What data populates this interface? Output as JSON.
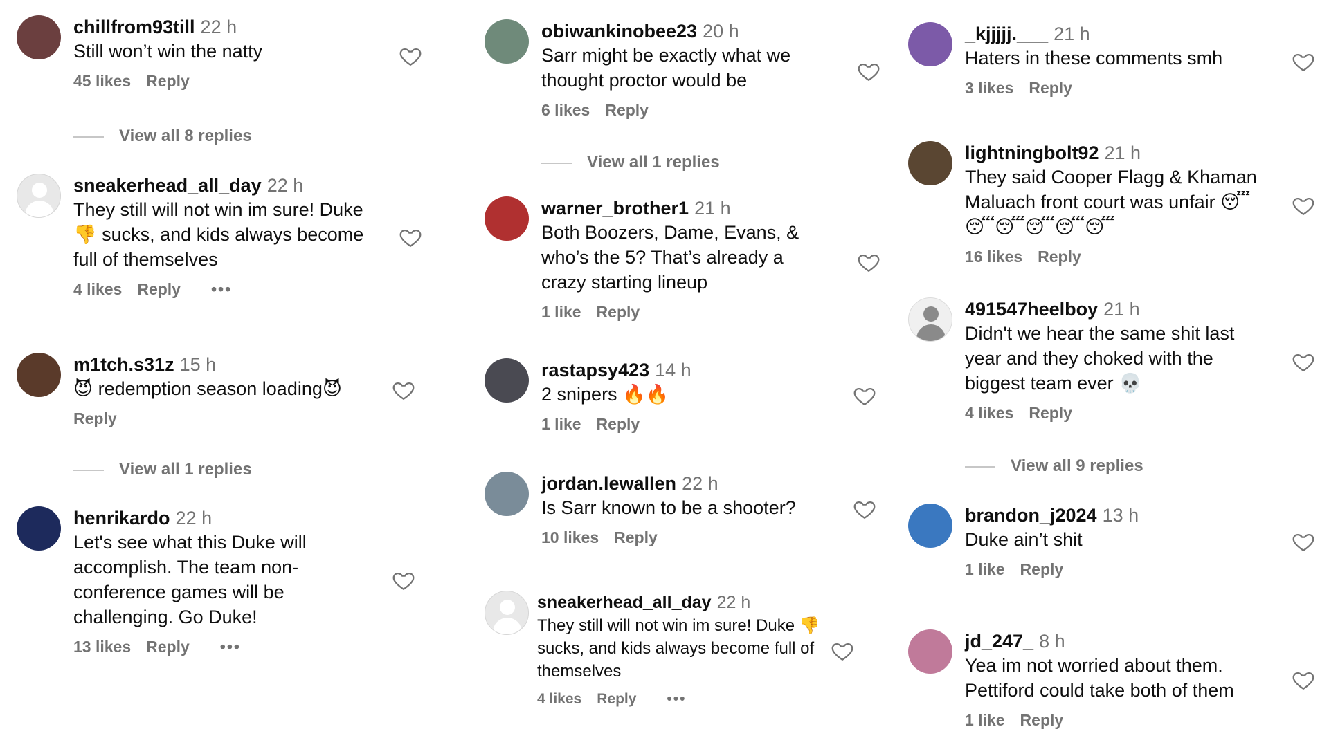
{
  "comments": [
    {
      "username": "chillfrom93till",
      "time": "22 h",
      "text": "Still won’t win the natty",
      "likes": "45 likes",
      "reply": "Reply",
      "dots": "",
      "avatar_color": "#6b3f3f"
    },
    {
      "username": "sneakerhead_all_day",
      "time": "22 h",
      "text": "They still will not win im sure! Duke 👎 sucks, and kids always become full of themselves",
      "likes": "4 likes",
      "reply": "Reply",
      "dots": "•••",
      "avatar_color": "#e8e8e8"
    },
    {
      "username": "m1tch.s31z",
      "time": "15 h",
      "text": "😈 redemption season loading😈",
      "likes": "",
      "reply": "Reply",
      "dots": "",
      "avatar_color": "#5a3a2a"
    },
    {
      "username": "henrikardo",
      "time": "22 h",
      "text": "Let's see what this Duke will accomplish. The team non-conference games will be challenging. Go Duke!",
      "likes": "13 likes",
      "reply": "Reply",
      "dots": "•••",
      "avatar_color": "#1d2a5c"
    },
    {
      "username": "obiwankinobee23",
      "time": "20 h",
      "text": "Sarr might be exactly what we thought proctor would be",
      "likes": "6 likes",
      "reply": "Reply",
      "dots": "",
      "avatar_color": "#6f8a7a"
    },
    {
      "username": "warner_brother1",
      "time": "21 h",
      "text": "Both Boozers, Dame, Evans, & who’s the 5? That’s already a crazy starting lineup",
      "likes": "1 like",
      "reply": "Reply",
      "dots": "",
      "avatar_color": "#b03030"
    },
    {
      "username": "rastapsy423",
      "time": "14 h",
      "text": "2 snipers 🔥🔥",
      "likes": "1 like",
      "reply": "Reply",
      "dots": "",
      "avatar_color": "#4a4a52"
    },
    {
      "username": "jordan.lewallen",
      "time": "22 h",
      "text": "Is Sarr known to be a shooter?",
      "likes": "10 likes",
      "reply": "Reply",
      "dots": "",
      "avatar_color": "#7a8c99"
    },
    {
      "username": "sneakerhead_all_day",
      "time": "22 h",
      "text": "They still will not win im sure! Duke 👎 sucks, and kids always become full of themselves",
      "likes": "4 likes",
      "reply": "Reply",
      "dots": "•••",
      "avatar_color": "#e8e8e8"
    },
    {
      "username": "_kjjjjj.___",
      "time": "21 h",
      "text": "Haters in these comments smh",
      "likes": "3 likes",
      "reply": "Reply",
      "dots": "",
      "avatar_color": "#7c5aa8"
    },
    {
      "username": "lightningbolt92",
      "time": "21 h",
      "text": "They said Cooper Flagg & Khaman Maluach front court was unfair 😴 😴😴😴😴😴",
      "likes": "16 likes",
      "reply": "Reply",
      "dots": "",
      "avatar_color": "#5a4632"
    },
    {
      "username": "491547heelboy",
      "time": "21 h",
      "text": "Didn't we hear the same shit last year and they choked with the biggest team ever 💀",
      "likes": "4 likes",
      "reply": "Reply",
      "dots": "",
      "avatar_color": "#f0f0f0"
    },
    {
      "username": "brandon_j2024",
      "time": "13 h",
      "text": "Duke ain’t shit",
      "likes": "1 like",
      "reply": "Reply",
      "dots": "",
      "avatar_color": "#3a78c0"
    },
    {
      "username": "jd_247_",
      "time": "8 h",
      "text": "Yea im not worried about them. Pettiford could take both of them",
      "likes": "1 like",
      "reply": "Reply",
      "dots": "",
      "avatar_color": "#c07a9a"
    }
  ],
  "view_replies": [
    "View all 8 replies",
    "View all 1 replies",
    "View all 1 replies",
    "View all 9 replies"
  ]
}
